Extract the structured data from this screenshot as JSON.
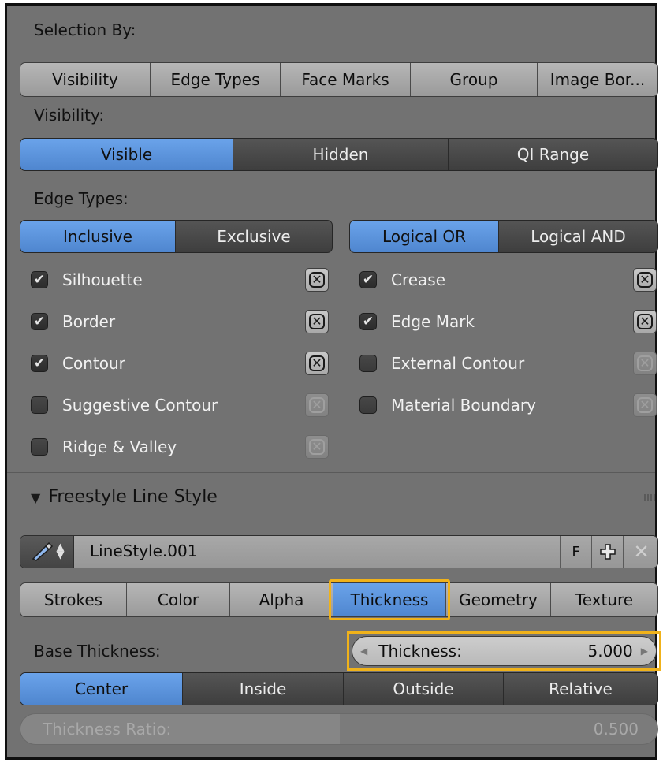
{
  "selection_by": {
    "label": "Selection By:",
    "tabs": [
      "Visibility",
      "Edge Types",
      "Face Marks",
      "Group",
      "Image Bor..."
    ]
  },
  "visibility": {
    "label": "Visibility:",
    "options": [
      "Visible",
      "Hidden",
      "QI Range"
    ],
    "selected": "Visible"
  },
  "edge_types": {
    "label": "Edge Types:",
    "mode": [
      "Inclusive",
      "Exclusive"
    ],
    "mode_selected": "Inclusive",
    "logic": [
      "Logical OR",
      "Logical AND"
    ],
    "logic_selected": "Logical OR",
    "left": [
      {
        "label": "Silhouette",
        "checked": true
      },
      {
        "label": "Border",
        "checked": true
      },
      {
        "label": "Contour",
        "checked": true
      },
      {
        "label": "Suggestive Contour",
        "checked": false
      },
      {
        "label": "Ridge & Valley",
        "checked": false
      }
    ],
    "right": [
      {
        "label": "Crease",
        "checked": true
      },
      {
        "label": "Edge Mark",
        "checked": true
      },
      {
        "label": "External Contour",
        "checked": false
      },
      {
        "label": "Material Boundary",
        "checked": false
      }
    ]
  },
  "line_style": {
    "panel_title": "Freestyle Line Style",
    "name": "LineStyle.001",
    "fake_user_label": "F",
    "tabs": [
      "Strokes",
      "Color",
      "Alpha",
      "Thickness",
      "Geometry",
      "Texture"
    ],
    "active_tab": "Thickness",
    "base_thickness_label": "Base Thickness:",
    "thickness_label": "Thickness:",
    "thickness_value": "5.000",
    "position_options": [
      "Center",
      "Inside",
      "Outside",
      "Relative"
    ],
    "position_selected": "Center",
    "ratio_label": "Thickness Ratio:",
    "ratio_value": "0.500"
  },
  "colors": {
    "panel_bg": "#727272",
    "active_blue": "#5b93dc",
    "highlight_outline": "#f0b21a"
  }
}
